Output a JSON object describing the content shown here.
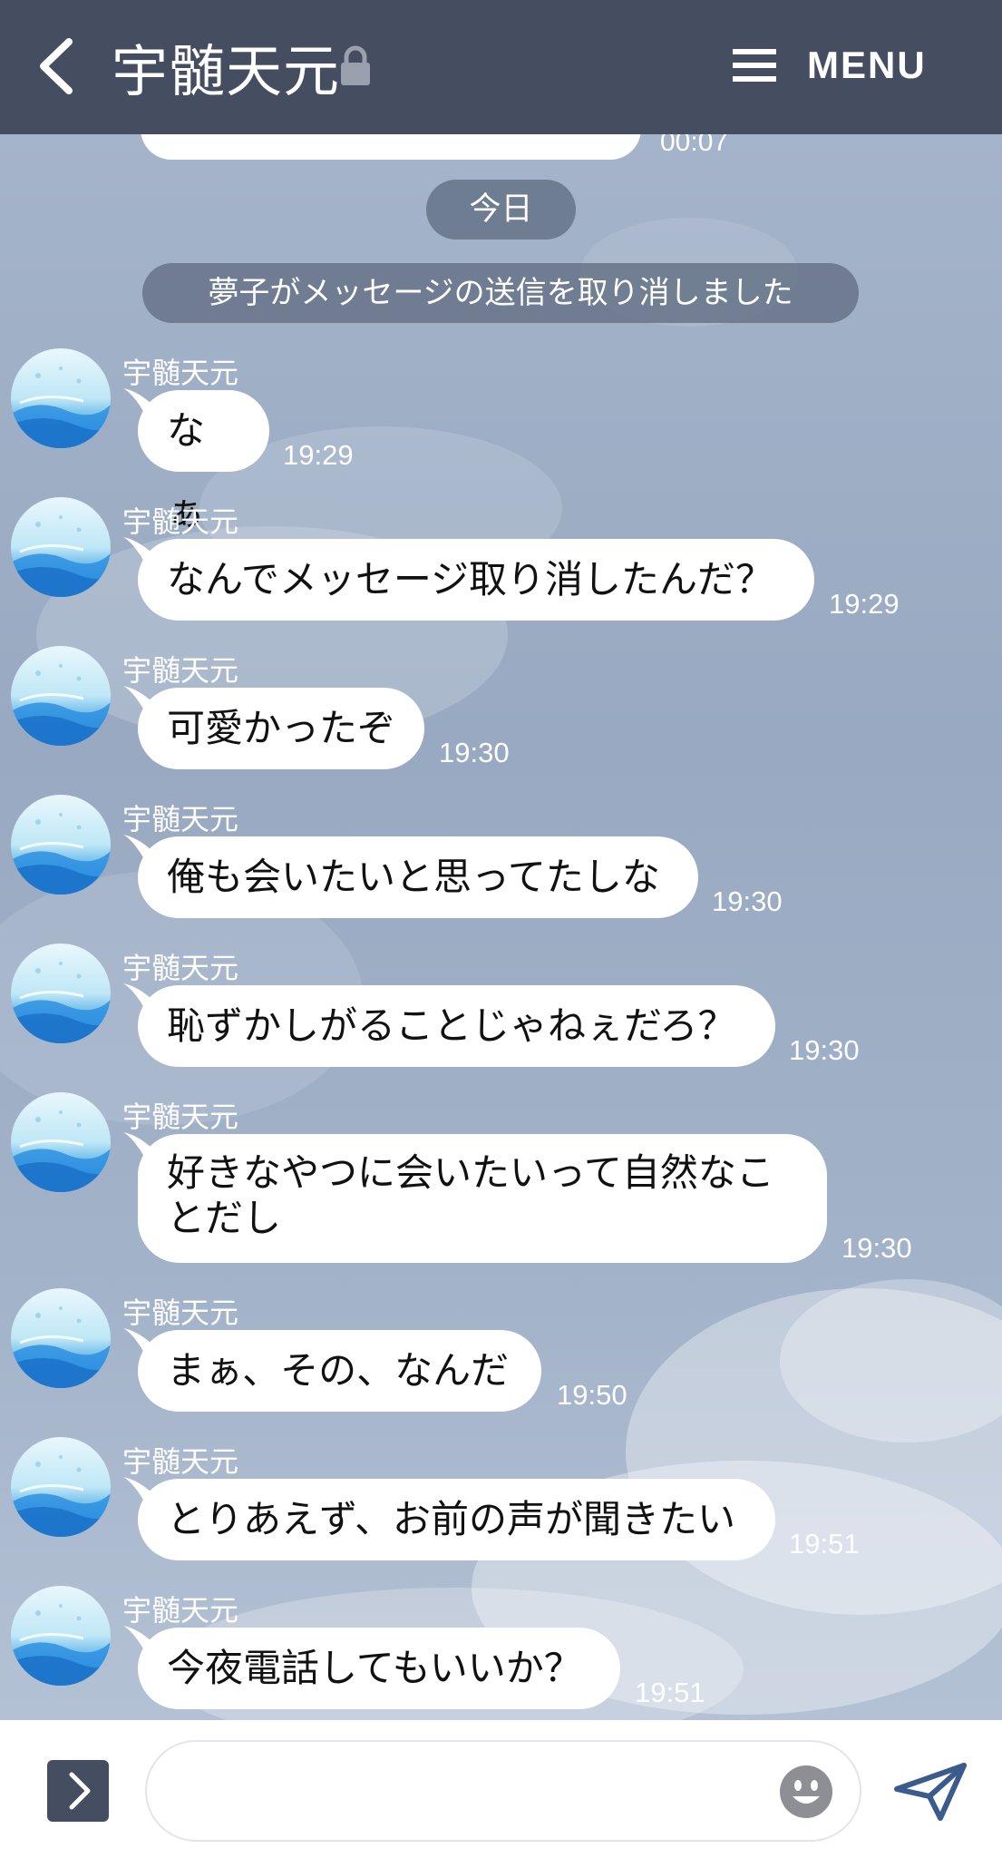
{
  "header": {
    "title": "宇髄天元",
    "menu_label": "MENU"
  },
  "chat": {
    "previous_time": "00:07",
    "date_separator": "今日",
    "system_notice": "夢子がメッセージの送信を取り消しました",
    "messages": [
      {
        "sender": "宇髄天元",
        "text": "なぁ",
        "time": "19:29"
      },
      {
        "sender": "宇髄天元",
        "text": "なんでメッセージ取り消したんだ？",
        "time": "19:29"
      },
      {
        "sender": "宇髄天元",
        "text": "可愛かったぞ",
        "time": "19:30"
      },
      {
        "sender": "宇髄天元",
        "text": "俺も会いたいと思ってたしな",
        "time": "19:30"
      },
      {
        "sender": "宇髄天元",
        "text": "恥ずかしがることじゃねぇだろ？",
        "time": "19:30"
      },
      {
        "sender": "宇髄天元",
        "text_line1": "好きなやつに会いたいって自然なこ",
        "text_line2": "とだし",
        "time": "19:30"
      },
      {
        "sender": "宇髄天元",
        "text": "まぁ、その、なんだ",
        "time": "19:50"
      },
      {
        "sender": "宇髄天元",
        "text": "とりあえず、お前の声が聞きたい",
        "time": "19:51"
      },
      {
        "sender": "宇髄天元",
        "text": "今夜電話してもいいか？",
        "time": "19:51"
      }
    ]
  },
  "composer": {
    "placeholder": ""
  },
  "colors": {
    "header_bg": "#454d61",
    "bubble_bg": "#ffffff",
    "send_icon": "#3b5b8c"
  },
  "icons": {
    "back": "chevron-left-icon",
    "lock": "lock-icon",
    "menu": "hamburger-icon",
    "expand": "chevron-right-icon",
    "emoji": "smiley-icon",
    "send": "paper-plane-icon"
  }
}
